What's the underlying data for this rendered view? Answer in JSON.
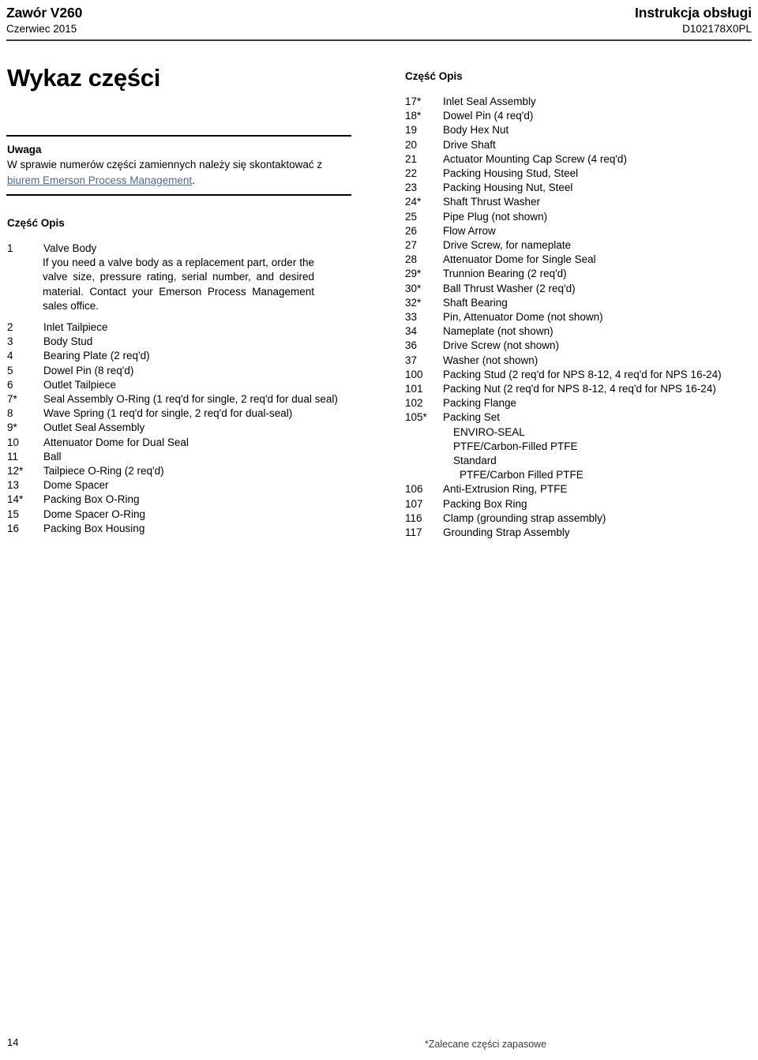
{
  "header": {
    "title": "Zawór V260",
    "date": "Czerwiec 2015",
    "doc_type": "Instrukcja obsługi",
    "doc_number": "D102178X0PL"
  },
  "page_title": "Wykaz części",
  "note": {
    "heading": "Uwaga",
    "text_before_link": "W sprawie numerów części zamiennych należy się skontaktować z ",
    "link_text": "biurem Emerson Process Management",
    "text_after_link": ".",
    "link_color": "#4a6a9a"
  },
  "left_column": {
    "list_heading": "Część Opis",
    "first_item": {
      "num": "1",
      "desc": "Valve Body",
      "paragraph": "If you need a valve body as a replacement part, order the valve size, pressure rating, serial number, and desired material. Contact your Emerson Process Management sales office."
    },
    "items": [
      {
        "num": "2",
        "desc": "Inlet Tailpiece"
      },
      {
        "num": "3",
        "desc": "Body Stud"
      },
      {
        "num": "4",
        "desc": "Bearing Plate (2 req'd)"
      },
      {
        "num": "5",
        "desc": "Dowel Pin (8 req'd)"
      },
      {
        "num": "6",
        "desc": "Outlet Tailpiece"
      },
      {
        "num": "7*",
        "desc": "Seal Assembly O-Ring (1 req'd for single, 2 req'd for dual seal)"
      },
      {
        "num": "8",
        "desc": "Wave Spring (1 req'd for single, 2 req'd for dual-seal)"
      },
      {
        "num": "9*",
        "desc": "Outlet Seal Assembly"
      },
      {
        "num": "10",
        "desc": "Attenuator Dome for Dual Seal"
      },
      {
        "num": "11",
        "desc": "Ball"
      },
      {
        "num": "12*",
        "desc": "Tailpiece O-Ring (2 req'd)"
      },
      {
        "num": "13",
        "desc": "Dome Spacer"
      },
      {
        "num": "14*",
        "desc": "Packing Box O-Ring"
      },
      {
        "num": "15",
        "desc": "Dome Spacer O-Ring"
      },
      {
        "num": "16",
        "desc": "Packing Box Housing"
      }
    ]
  },
  "right_column": {
    "list_heading": "Część Opis",
    "items": [
      {
        "num": "17*",
        "desc": "Inlet Seal Assembly",
        "indent": 0
      },
      {
        "num": "18*",
        "desc": "Dowel Pin (4 req'd)",
        "indent": 0
      },
      {
        "num": "19",
        "desc": "Body Hex Nut",
        "indent": 0
      },
      {
        "num": "20",
        "desc": "Drive Shaft",
        "indent": 0
      },
      {
        "num": "21",
        "desc": "Actuator Mounting Cap Screw (4 req'd)",
        "indent": 0
      },
      {
        "num": "22",
        "desc": "Packing Housing Stud, Steel",
        "indent": 0
      },
      {
        "num": "23",
        "desc": "Packing Housing Nut, Steel",
        "indent": 0
      },
      {
        "num": "24*",
        "desc": "Shaft Thrust Washer",
        "indent": 0
      },
      {
        "num": "25",
        "desc": "Pipe Plug (not shown)",
        "indent": 0
      },
      {
        "num": "26",
        "desc": "Flow Arrow",
        "indent": 0
      },
      {
        "num": "27",
        "desc": "Drive Screw, for nameplate",
        "indent": 0
      },
      {
        "num": "28",
        "desc": "Attenuator Dome for Single Seal",
        "indent": 0
      },
      {
        "num": "29*",
        "desc": "Trunnion Bearing (2 req'd)",
        "indent": 0
      },
      {
        "num": "30*",
        "desc": "Ball Thrust Washer (2 req'd)",
        "indent": 0
      },
      {
        "num": "32*",
        "desc": "Shaft Bearing",
        "indent": 0
      },
      {
        "num": "33",
        "desc": "Pin, Attenuator Dome (not shown)",
        "indent": 0
      },
      {
        "num": "34",
        "desc": "Nameplate (not shown)",
        "indent": 0
      },
      {
        "num": "36",
        "desc": "Drive Screw (not shown)",
        "indent": 0
      },
      {
        "num": "37",
        "desc": "Washer (not shown)",
        "indent": 0
      },
      {
        "num": "100",
        "desc": "Packing Stud (2 req'd for NPS 8-12, 4 req'd for NPS 16-24)",
        "indent": 0
      },
      {
        "num": "101",
        "desc": "Packing Nut (2 req'd for NPS 8-12, 4 req'd for NPS 16-24)",
        "indent": 0
      },
      {
        "num": "102",
        "desc": "Packing Flange",
        "indent": 0
      },
      {
        "num": "105*",
        "desc": "Packing Set",
        "indent": 0
      },
      {
        "num": "",
        "desc": "ENVIRO-SEAL",
        "indent": 1
      },
      {
        "num": "",
        "desc": "PTFE/Carbon-Filled PTFE",
        "indent": 1
      },
      {
        "num": "",
        "desc": "Standard",
        "indent": 1
      },
      {
        "num": "",
        "desc": "PTFE/Carbon Filled PTFE",
        "indent": 2
      },
      {
        "num": "106",
        "desc": "Anti-Extrusion Ring, PTFE",
        "indent": 0
      },
      {
        "num": "107",
        "desc": "Packing Box Ring",
        "indent": 0
      },
      {
        "num": "116",
        "desc": "Clamp (grounding strap assembly)",
        "indent": 0
      },
      {
        "num": "117",
        "desc": "Grounding Strap Assembly",
        "indent": 0
      }
    ]
  },
  "footer": {
    "page_number": "14",
    "note": "*Zalecane części zapasowe"
  }
}
